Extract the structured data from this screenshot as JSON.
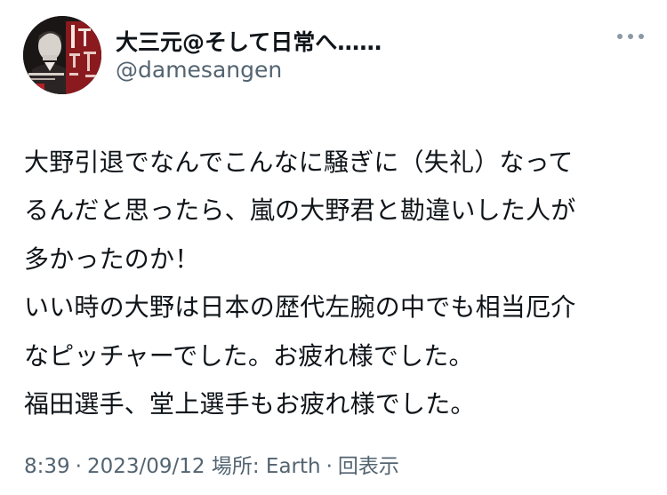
{
  "user": {
    "display_name": "大三元@そして日常へ……",
    "handle": "@damesangen",
    "avatar": "profile-avatar-book-cover"
  },
  "tweet": {
    "lines": [
      "大野引退でなんでこんなに騒ぎに（失礼）なって",
      "るんだと思ったら、嵐の大野君と勘違いした人が",
      "多かったのか！",
      "いい時の大野は日本の歴代左腕の中でも相当厄介",
      "なピッチャーでした。お疲れ様でした。",
      "福田選手、堂上選手もお疲れ様でした。"
    ]
  },
  "meta": {
    "time": "8:39",
    "date": "2023/09/12",
    "location": "場所: Earth",
    "views_label": "回表示",
    "separator": "·"
  },
  "icons": {
    "more": "more-horizontal-icon"
  },
  "colors": {
    "text": "#0f1419",
    "secondary": "#536471",
    "background": "#ffffff"
  }
}
